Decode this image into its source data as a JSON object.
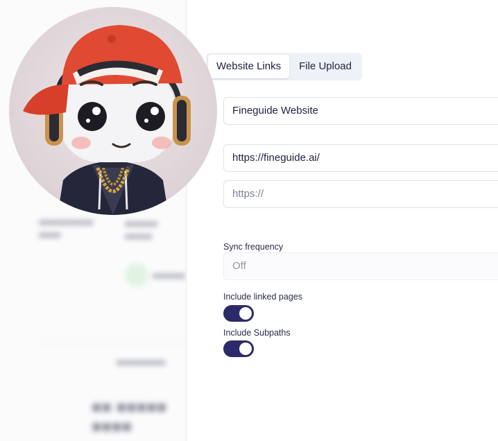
{
  "tabs": [
    {
      "label": "Website Links",
      "active": true
    },
    {
      "label": "File Upload",
      "active": false
    }
  ],
  "form": {
    "name_value": "Fineguide Website",
    "url_value": "https://fineguide.ai/",
    "url_placeholder": "https://",
    "sync_label": "Sync frequency",
    "sync_value": "Off",
    "linked_label": "Include linked pages",
    "linked_on": true,
    "subpaths_label": "Include Subpaths",
    "subpaths_on": true
  },
  "colors": {
    "toggle_on": "#2c2a6b",
    "tab_bg": "#eef1f7",
    "cap_red": "#e04a32"
  },
  "icons": [
    "mascot-avatar",
    "status-check-icon"
  ]
}
